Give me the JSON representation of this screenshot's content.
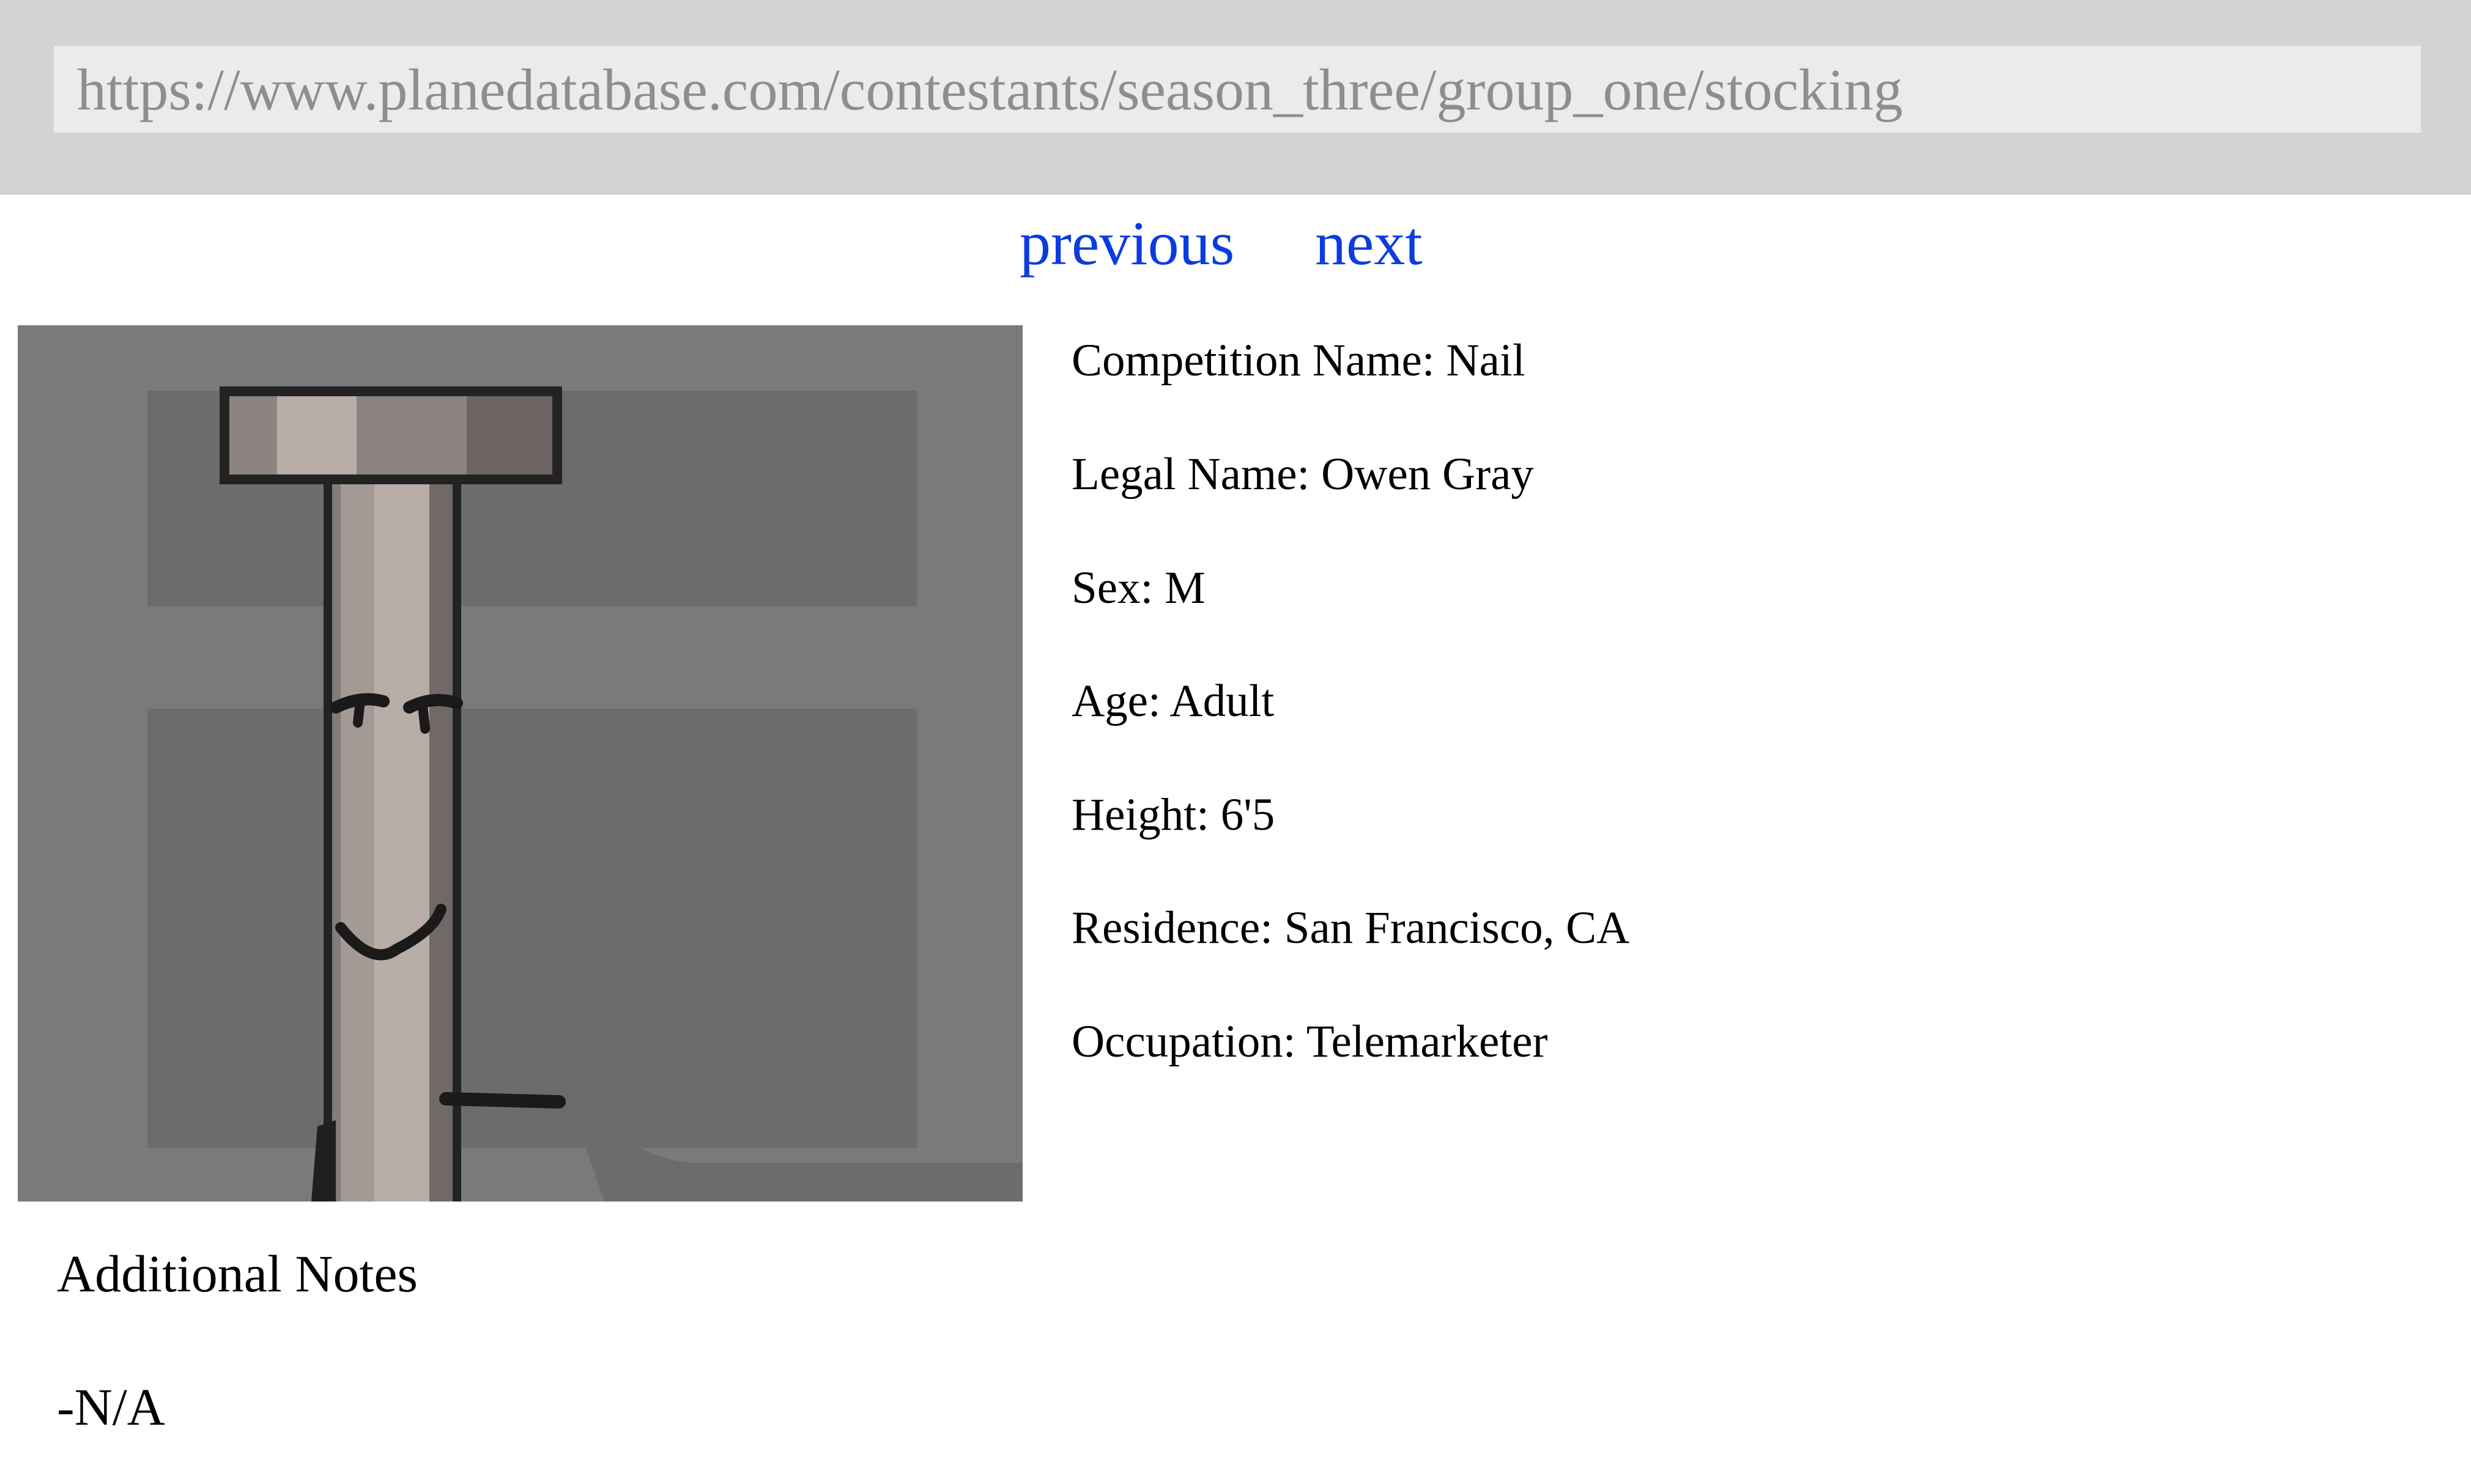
{
  "browser": {
    "url": "https://www.planedatabase.com/contestants/season_three/group_one/stocking"
  },
  "nav": {
    "previous_label": "previous",
    "next_label": "next",
    "link_color": "#0b3ce0"
  },
  "photo": {
    "icon": "nail-character-portrait",
    "background_color": "#7a7a7a"
  },
  "details": [
    {
      "label": "Competition Name",
      "value": "Nail",
      "text": "Competition Name: Nail"
    },
    {
      "label": "Legal Name",
      "value": "Owen Gray",
      "text": "Legal Name: Owen Gray"
    },
    {
      "label": "Sex",
      "value": "M",
      "text": "Sex: M"
    },
    {
      "label": "Age",
      "value": "Adult",
      "text": "Age: Adult"
    },
    {
      "label": "Height",
      "value": "6'5",
      "text": "Height: 6'5"
    },
    {
      "label": "Residence",
      "value": "San Francisco, CA",
      "text": "Residence: San Francisco, CA"
    },
    {
      "label": "Occupation",
      "value": "Telemarketer",
      "text": "Occupation: Telemarketer"
    }
  ],
  "notes": {
    "title": "Additional Notes",
    "body": "-N/A"
  }
}
